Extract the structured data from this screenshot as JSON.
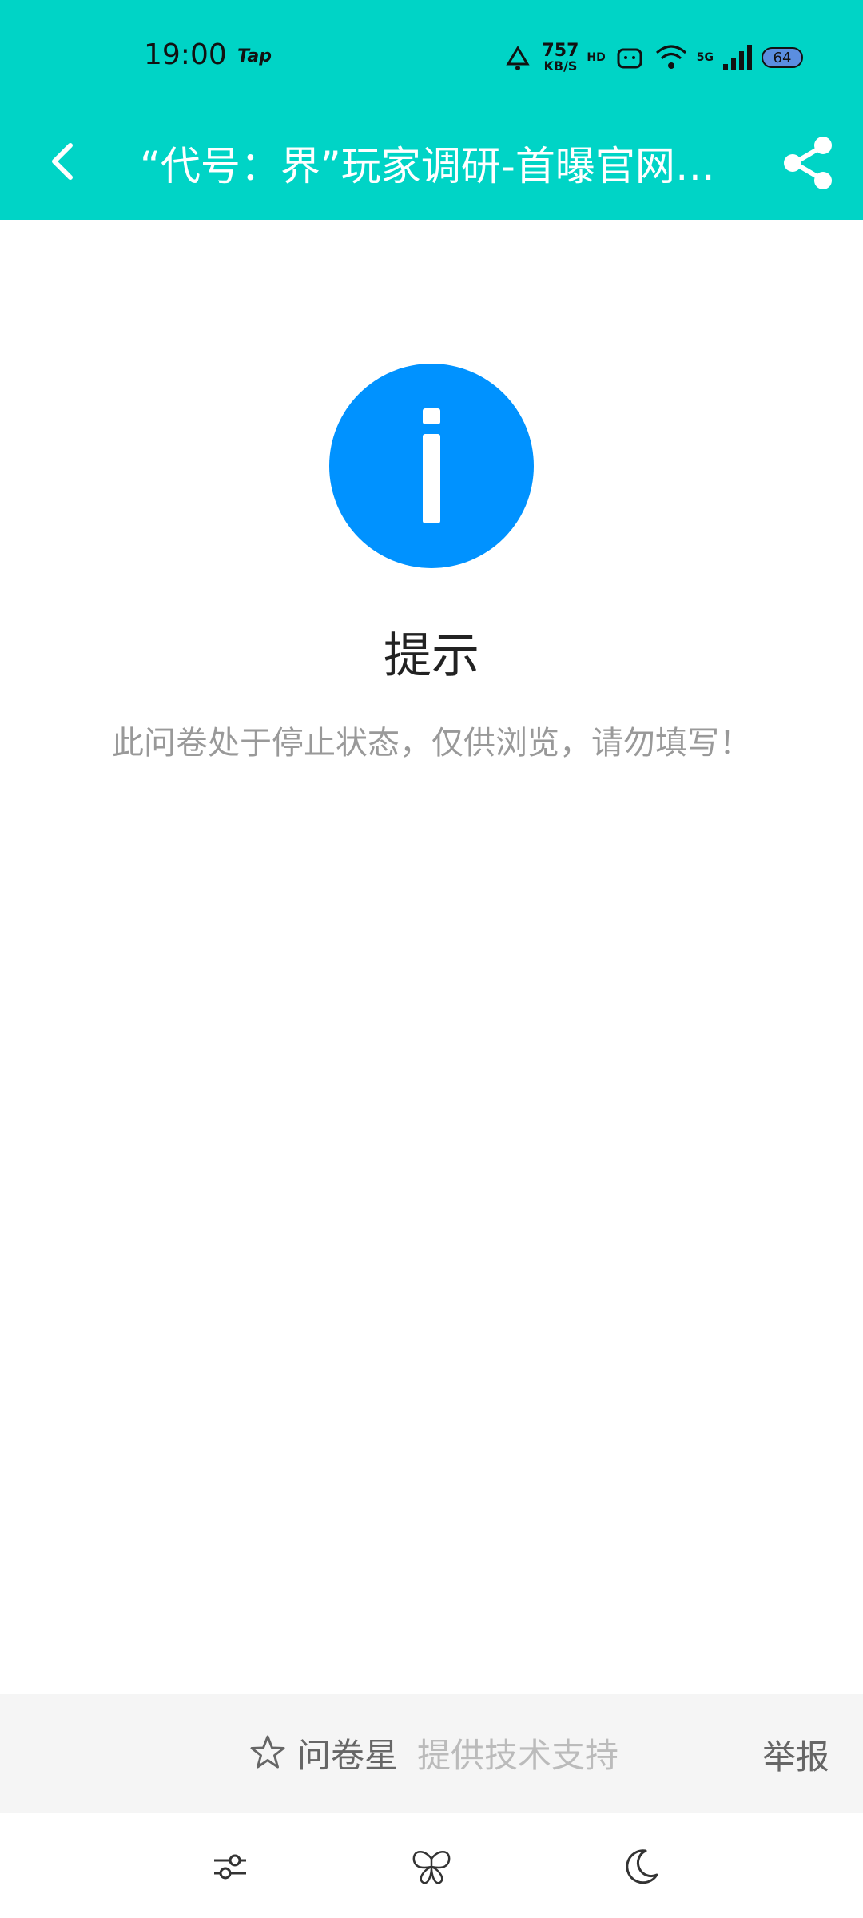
{
  "status_bar": {
    "time": "19:00",
    "app_badge": "Tap",
    "net_speed": "757",
    "net_speed_unit": "KB/S",
    "hd_label": "HD",
    "network_type": "5G",
    "battery": "64"
  },
  "header": {
    "title": "“代号：界”玩家调研-首曝官网问卷",
    "background_color": "#00d4c6"
  },
  "notice": {
    "icon": "info-icon",
    "icon_color": "#0092ff",
    "title": "提示",
    "message": "此问卷处于停止状态，仅供浏览，请勿填写！"
  },
  "footer": {
    "brand_name": "问卷星",
    "tech_support": "提供技术支持",
    "report": "举报"
  },
  "toolbar": {
    "icons": [
      "sliders-icon",
      "butterfly-icon",
      "moon-icon"
    ]
  }
}
